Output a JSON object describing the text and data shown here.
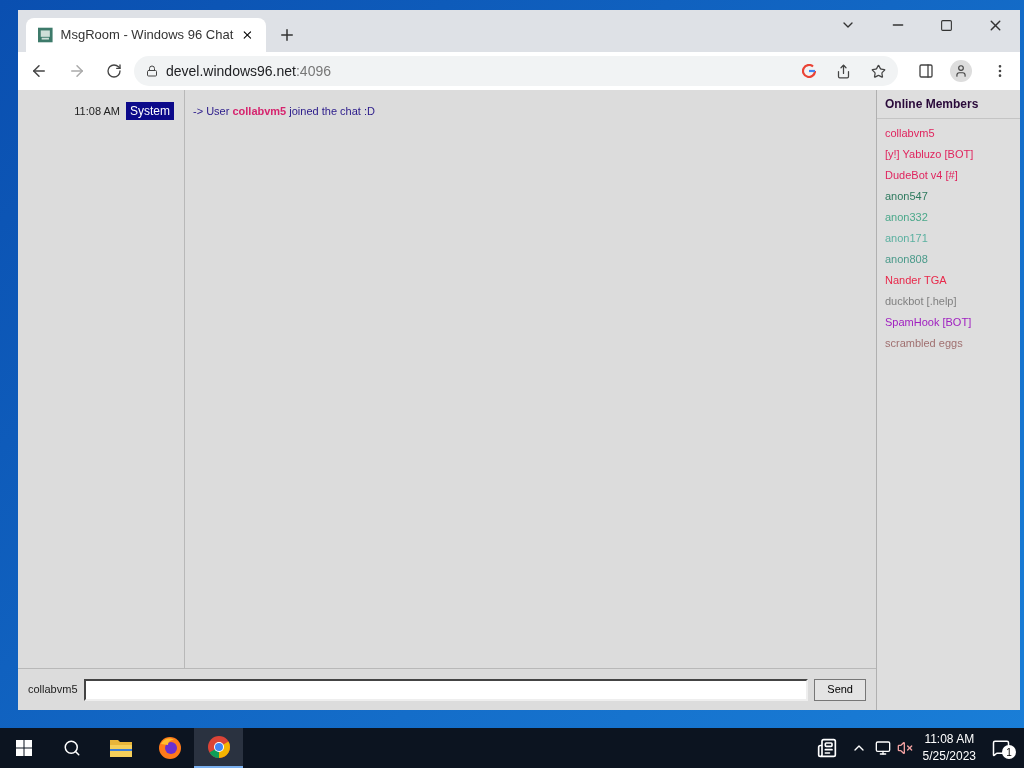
{
  "browser": {
    "tab_title": "MsgRoom - Windows 96 Chat",
    "url_host": "devel.windows96.net",
    "url_port": ":4096"
  },
  "messages": [
    {
      "time": "11:08 AM",
      "sender": "System",
      "text": "-> User **collabvm5** joined the chat :D"
    }
  ],
  "members": {
    "title": "Online Members",
    "items": [
      {
        "name": "collabvm5",
        "color": "#e0245e"
      },
      {
        "name": "[y!] Yabluzo [BOT]",
        "color": "#e0245e"
      },
      {
        "name": "DudeBot v4 [#]",
        "color": "#e0245e"
      },
      {
        "name": "anon547",
        "color": "#2e7a5e"
      },
      {
        "name": "anon332",
        "color": "#4aa88a"
      },
      {
        "name": "anon171",
        "color": "#5ab0a0"
      },
      {
        "name": "anon808",
        "color": "#4a9a8a"
      },
      {
        "name": "Nander TGA",
        "color": "#e8284a"
      },
      {
        "name": "duckbot [.help]",
        "color": "#808080"
      },
      {
        "name": "SpamHook [BOT]",
        "color": "#a020c0"
      },
      {
        "name": "scrambled eggs",
        "color": "#a07070"
      }
    ]
  },
  "composer": {
    "nickname": "collabvm5",
    "send": "Send"
  },
  "taskbar": {
    "apps": [
      {
        "kind": "folder",
        "selected": false
      },
      {
        "kind": "firefox",
        "selected": false
      },
      {
        "kind": "chrome",
        "selected": true
      }
    ],
    "time": "11:08 AM",
    "date": "5/25/2023",
    "notifications": "1"
  }
}
